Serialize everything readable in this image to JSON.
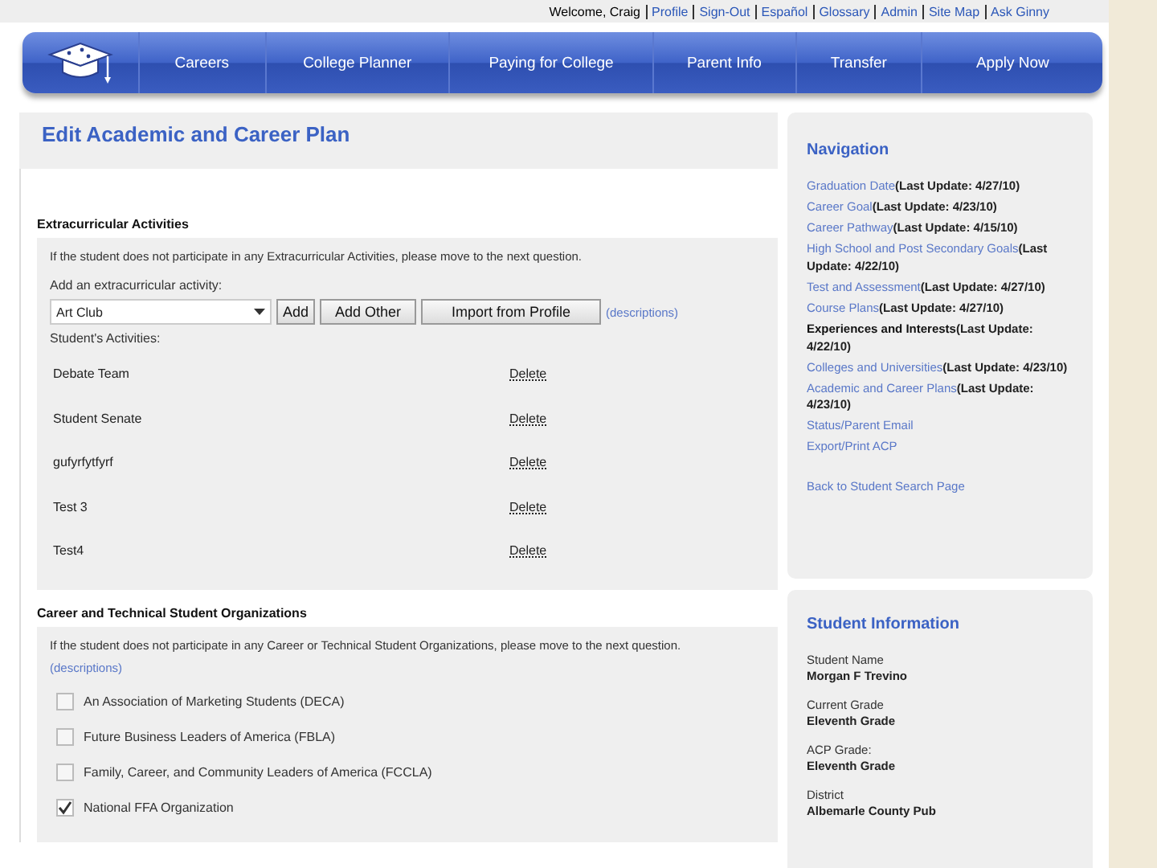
{
  "top_links": {
    "welcome": "Welcome, Craig",
    "links": [
      "Profile",
      "Sign-Out",
      "Español",
      "Glossary",
      "Admin",
      "Site Map",
      "Ask Ginny"
    ]
  },
  "nav_bar": {
    "items": [
      "Careers",
      "College Planner",
      "Paying for College",
      "Parent Info",
      "Transfer",
      "Apply Now"
    ]
  },
  "page_title": "Edit Academic and Career Plan",
  "extracurricular": {
    "heading": "Extracurricular Activities",
    "note": "If the student does not participate in any Extracurricular Activities, please move to the next question.",
    "add_label": "Add an extracurricular activity:",
    "select_value": "Art Club",
    "buttons": [
      "Add",
      "Add Other",
      "Import from Profile"
    ],
    "descriptions_link": "(descriptions)",
    "list_label": "Student's Activities:",
    "activities": [
      {
        "name": "Debate Team",
        "action": "Delete"
      },
      {
        "name": "Student Senate",
        "action": "Delete"
      },
      {
        "name": "gufyrfytfyrf",
        "action": "Delete"
      },
      {
        "name": "Test 3",
        "action": "Delete"
      },
      {
        "name": "Test4",
        "action": "Delete"
      }
    ]
  },
  "organizations": {
    "heading": "Career and Technical Student Organizations",
    "note": "If the student does not participate in any Career or Technical Student Organizations, please move to the next question.",
    "descriptions_link": "(descriptions)",
    "options": [
      {
        "label": "An Association of Marketing Students (DECA)",
        "checked": false
      },
      {
        "label": "Future Business Leaders of America (FBLA)",
        "checked": false
      },
      {
        "label": "Family, Career, and Community Leaders of America (FCCLA)",
        "checked": false
      },
      {
        "label": "National FFA Organization",
        "checked": true
      }
    ]
  },
  "navigation": {
    "title": "Navigation",
    "items": [
      {
        "label": "Graduation Date",
        "note": "(Last Update: 4/27/10)",
        "current": false
      },
      {
        "label": "Career Goal",
        "note": "(Last Update: 4/23/10)",
        "current": false
      },
      {
        "label": "Career Pathway",
        "note": "(Last Update: 4/15/10)",
        "current": false
      },
      {
        "label": "High School and Post Secondary Goals",
        "note": "(Last Update: 4/22/10)",
        "current": false
      },
      {
        "label": "Test and Assessment",
        "note": "(Last Update: 4/27/10)",
        "current": false
      },
      {
        "label": "Course Plans",
        "note": "(Last Update: 4/27/10)",
        "current": false
      },
      {
        "label": "Experiences and Interests",
        "note": "(Last Update: 4/22/10)",
        "current": true
      },
      {
        "label": "Colleges and Universities",
        "note": "(Last Update: 4/23/10)",
        "current": false
      },
      {
        "label": "Academic and Career Plans",
        "note": "(Last Update: 4/23/10)",
        "current": false
      },
      {
        "label": "Status/Parent Email",
        "current": false
      },
      {
        "label": "Export/Print ACP",
        "current": false
      }
    ],
    "back_link": "Back to Student Search Page"
  },
  "student_info": {
    "title": "Student Information",
    "fields": [
      {
        "label": "Student Name",
        "value": "Morgan F Trevino"
      },
      {
        "label": "Current Grade",
        "value": "Eleventh Grade"
      },
      {
        "label": "ACP Grade:",
        "value": "Eleventh Grade"
      },
      {
        "label": "District",
        "value": "Albemarle County Pub"
      }
    ]
  }
}
